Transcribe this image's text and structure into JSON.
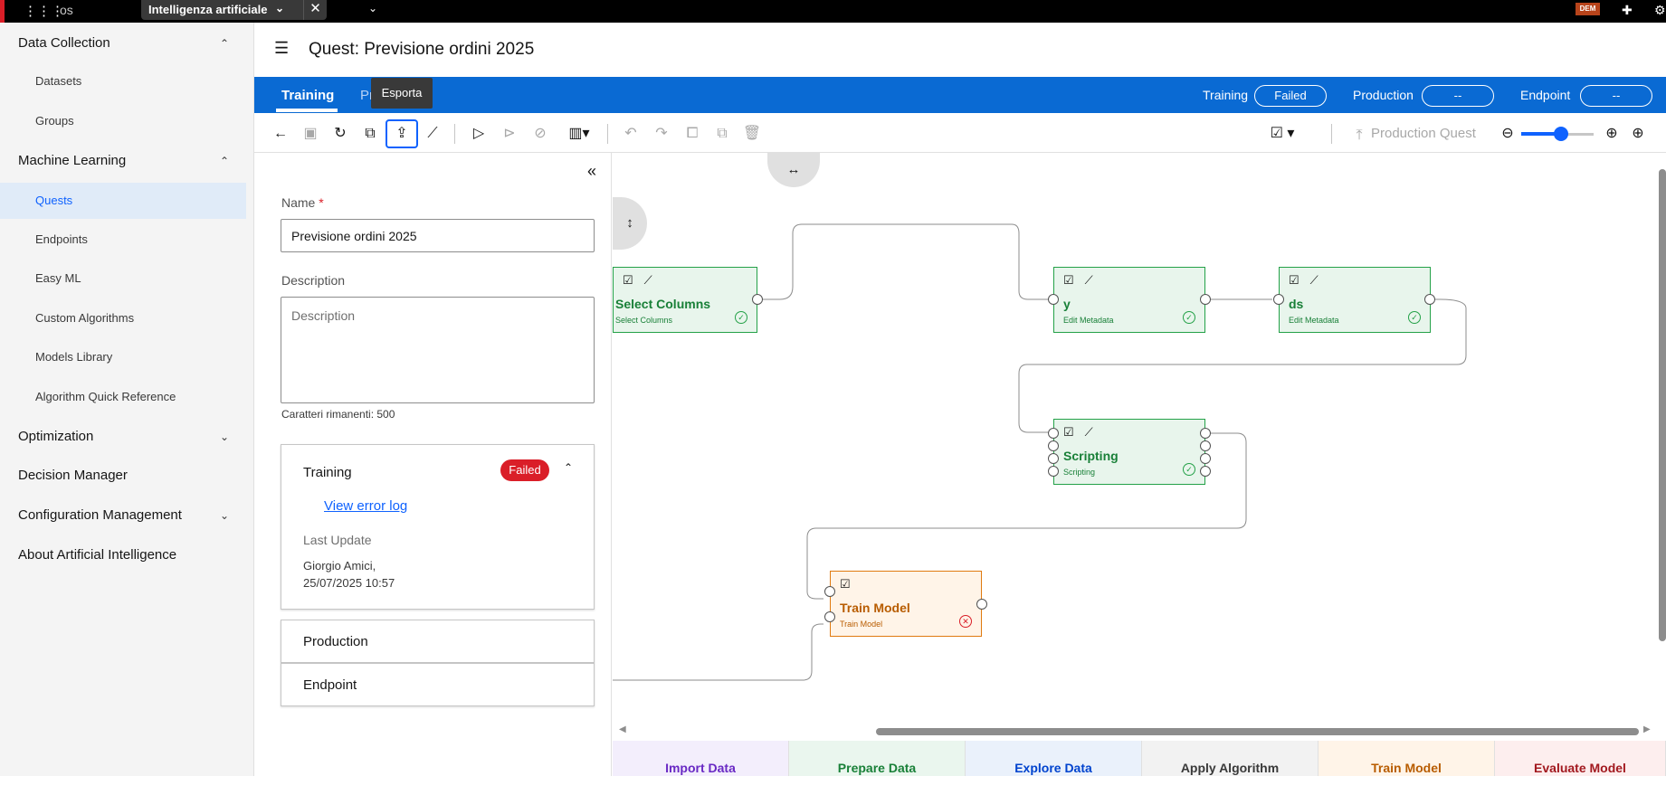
{
  "topbar": {
    "app_short": "os",
    "tab_title": "Intelligenza artificiale",
    "user_badge": "DEM"
  },
  "sidebar": {
    "sections": [
      {
        "label": "Data Collection",
        "expanded": true,
        "items": [
          "Datasets",
          "Groups"
        ]
      },
      {
        "label": "Machine Learning",
        "expanded": true,
        "items": [
          "Quests",
          "Endpoints",
          "Easy ML",
          "Custom Algorithms",
          "Models Library",
          "Algorithm Quick Reference"
        ]
      },
      {
        "label": "Optimization",
        "expanded": false,
        "items": []
      },
      {
        "label": "Decision Manager",
        "expanded": false,
        "items": []
      },
      {
        "label": "Configuration Management",
        "expanded": false,
        "items": []
      },
      {
        "label": "About Artificial Intelligence",
        "expanded": false,
        "items": []
      }
    ],
    "active_item": "Quests"
  },
  "header": {
    "title": "Quest: Previsione ordini 2025"
  },
  "tabs": {
    "training": "Training",
    "production_partial": "Pr"
  },
  "status": {
    "training_label": "Training",
    "training_value": "Failed",
    "production_label": "Production",
    "production_value": "--",
    "endpoint_label": "Endpoint",
    "endpoint_value": "--"
  },
  "tooltip": "Esporta",
  "toolbar": {
    "production_quest": "Production Quest",
    "zoom_level_fraction": 0.55
  },
  "form": {
    "name_label": "Name",
    "name_required_mark": "*",
    "name_value": "Previsione ordini 2025",
    "description_label": "Description",
    "description_placeholder": "Description",
    "remaining": "Caratteri rimanenti: 500"
  },
  "cards": {
    "training": {
      "title": "Training",
      "badge": "Failed",
      "error_link": "View error log",
      "last_update_label": "Last Update",
      "last_update_user": "Giorgio Amici,",
      "last_update_time": "25/07/2025 10:57"
    },
    "production": {
      "title": "Production"
    },
    "endpoint": {
      "title": "Endpoint"
    }
  },
  "nodes": [
    {
      "id": "select-columns",
      "title": "Select Columns",
      "subtitle": "Select Columns",
      "status": "success",
      "color": "green"
    },
    {
      "id": "y",
      "title": "y",
      "subtitle": "Edit Metadata",
      "status": "success",
      "color": "green"
    },
    {
      "id": "ds",
      "title": "ds",
      "subtitle": "Edit Metadata",
      "status": "success",
      "color": "green"
    },
    {
      "id": "scripting",
      "title": "Scripting",
      "subtitle": "Scripting",
      "status": "success",
      "color": "green"
    },
    {
      "id": "train-model",
      "title": "Train Model",
      "subtitle": "Train Model",
      "status": "error",
      "color": "orange"
    }
  ],
  "palette": [
    {
      "label": "Import Data",
      "color": "#6929c4",
      "bg": "#f3eefc"
    },
    {
      "label": "Prepare Data",
      "color": "#198038",
      "bg": "#eaf6ee"
    },
    {
      "label": "Explore Data",
      "color": "#0043ce",
      "bg": "#eaf1fb"
    },
    {
      "label": "Apply Algorithm",
      "color": "#393939",
      "bg": "#f2f2f2"
    },
    {
      "label": "Train Model",
      "color": "#b85c00",
      "bg": "#fff4e8"
    },
    {
      "label": "Evaluate Model",
      "color": "#a2191f",
      "bg": "#fdeeee"
    }
  ]
}
